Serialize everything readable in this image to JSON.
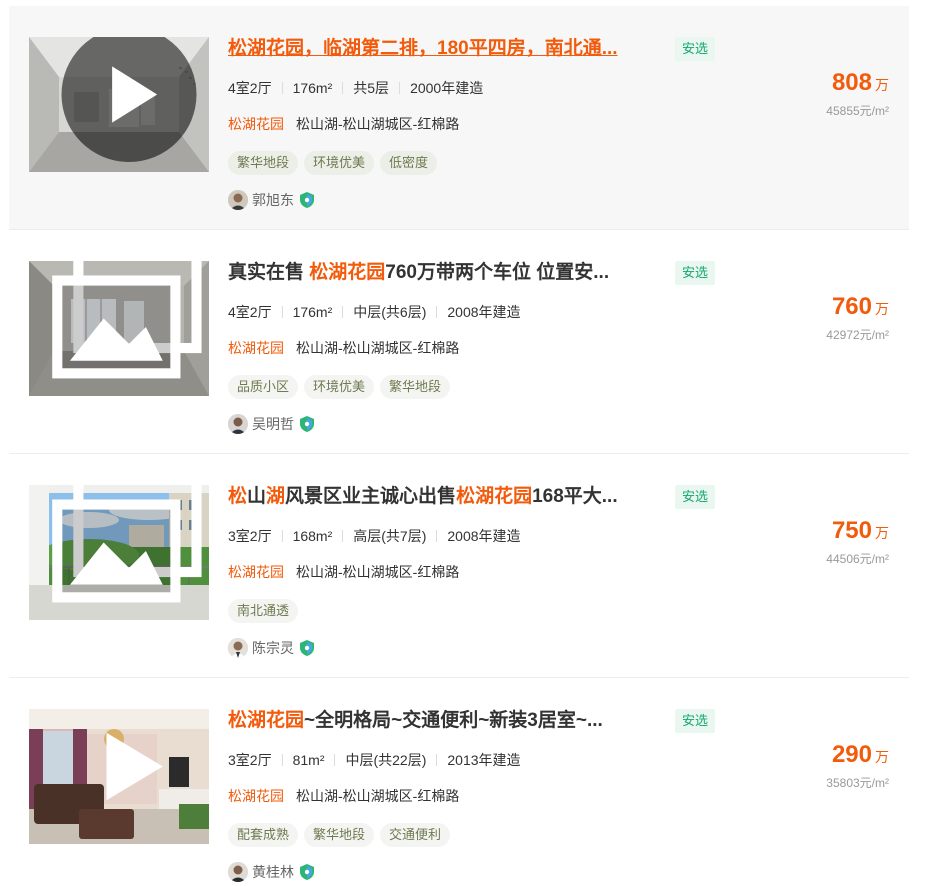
{
  "listings": [
    {
      "title_parts": [
        {
          "text": "松湖花园，临湖第二排，180平四房，南北通...",
          "hl": false
        }
      ],
      "tag_badge": "安选",
      "info": [
        "4室2厅",
        "176m²",
        "共5层",
        "2000年建造"
      ],
      "community": "松湖花园",
      "region": "松山湖-松山湖城区-红棉路",
      "tags": [
        "繁华地段",
        "环境优美",
        "低密度"
      ],
      "agent": "郭旭东",
      "total": "808",
      "wan": "万",
      "unit_price": "45855元/m²",
      "media_icon": "play-icon"
    },
    {
      "title_parts": [
        {
          "text": "真实在售 ",
          "hl": false
        },
        {
          "text": "松湖花园",
          "hl": true
        },
        {
          "text": "760万带两个车位 位置安...",
          "hl": false
        }
      ],
      "tag_badge": "安选",
      "info": [
        "4室2厅",
        "176m²",
        "中层(共6层)",
        "2008年建造"
      ],
      "community": "松湖花园",
      "region": "松山湖-松山湖城区-红棉路",
      "tags": [
        "品质小区",
        "环境优美",
        "繁华地段"
      ],
      "agent": "吴明哲",
      "total": "760",
      "wan": "万",
      "unit_price": "42972元/m²",
      "media_icon": "gallery-icon"
    },
    {
      "title_parts": [
        {
          "text": "松",
          "hl": true
        },
        {
          "text": "山",
          "hl": false
        },
        {
          "text": "湖",
          "hl": true
        },
        {
          "text": "风景区业主诚心出售",
          "hl": false
        },
        {
          "text": "松湖花园",
          "hl": true
        },
        {
          "text": "168平大...",
          "hl": false
        }
      ],
      "tag_badge": "安选",
      "info": [
        "3室2厅",
        "168m²",
        "高层(共7层)",
        "2008年建造"
      ],
      "community": "松湖花园",
      "region": "松山湖-松山湖城区-红棉路",
      "tags": [
        "南北通透"
      ],
      "agent": "陈宗灵",
      "total": "750",
      "wan": "万",
      "unit_price": "44506元/m²",
      "media_icon": "gallery-icon"
    },
    {
      "title_parts": [
        {
          "text": "松湖花园",
          "hl": true
        },
        {
          "text": "~全明格局~交通便利~新装3居室~...",
          "hl": false
        }
      ],
      "tag_badge": "安选",
      "info": [
        "3室2厅",
        "81m²",
        "中层(共22层)",
        "2013年建造"
      ],
      "community": "松湖花园",
      "region": "松山湖-松山湖城区-红棉路",
      "tags": [
        "配套成熟",
        "繁华地段",
        "交通便利"
      ],
      "agent": "黄桂林",
      "total": "290",
      "wan": "万",
      "unit_price": "35803元/m²",
      "media_icon": "play-icon"
    }
  ],
  "colors": {
    "accent": "#f25b0b",
    "badge_green": "#14a870",
    "tag_text": "#6e7a4f"
  }
}
